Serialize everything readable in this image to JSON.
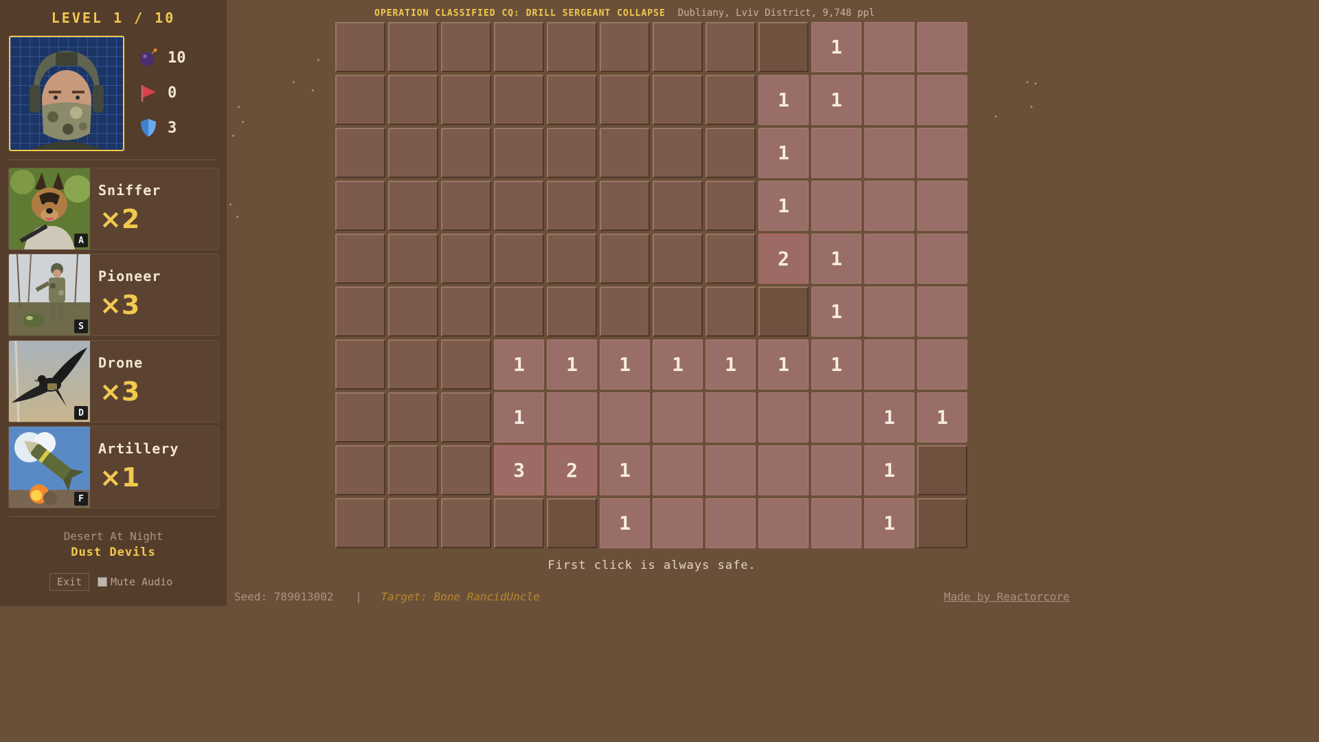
{
  "sidebar": {
    "level_text": "LEVEL 1 / 10",
    "stats": {
      "mines": "10",
      "flags": "0",
      "shields": "3"
    },
    "units": [
      {
        "name": "Sniffer",
        "count": "×2",
        "key": "A",
        "icon": "dog-icon"
      },
      {
        "name": "Pioneer",
        "count": "×3",
        "key": "S",
        "icon": "soldier-icon"
      },
      {
        "name": "Drone",
        "count": "×3",
        "key": "D",
        "icon": "bird-drone-icon"
      },
      {
        "name": "Artillery",
        "count": "×1",
        "key": "F",
        "icon": "missile-icon"
      }
    ],
    "theme": "Desert At Night",
    "theme_name": "Dust Devils",
    "exit_label": "Exit",
    "mute_label": "Mute Audio"
  },
  "header": {
    "title": "OPERATION CLASSIFIED CQ: DRILL SERGEANT COLLAPSE",
    "location": "Dubliany, Lviv District, 9,748 ppl"
  },
  "board": {
    "legend": "H = hidden tile, D = hidden darker tile, . = revealed empty, digit = revealed number",
    "rows": [
      [
        "H",
        "H",
        "H",
        "H",
        "H",
        "H",
        "H",
        "H",
        "D",
        "1",
        ".",
        "."
      ],
      [
        "H",
        "H",
        "H",
        "H",
        "H",
        "H",
        "H",
        "H",
        "1",
        "1",
        ".",
        "."
      ],
      [
        "H",
        "H",
        "H",
        "H",
        "H",
        "H",
        "H",
        "H",
        "1",
        ".",
        ".",
        "."
      ],
      [
        "H",
        "H",
        "H",
        "H",
        "H",
        "H",
        "H",
        "H",
        "1",
        ".",
        ".",
        "."
      ],
      [
        "H",
        "H",
        "H",
        "H",
        "H",
        "H",
        "H",
        "H",
        "2",
        "1",
        ".",
        "."
      ],
      [
        "H",
        "H",
        "H",
        "H",
        "H",
        "H",
        "H",
        "H",
        "D",
        "1",
        ".",
        "."
      ],
      [
        "H",
        "H",
        "H",
        "1",
        "1",
        "1",
        "1",
        "1",
        "1",
        "1",
        ".",
        "."
      ],
      [
        "H",
        "H",
        "H",
        "1",
        ".",
        ".",
        ".",
        ".",
        ".",
        ".",
        "1",
        "1"
      ],
      [
        "H",
        "H",
        "H",
        "3",
        "2",
        "1",
        ".",
        ".",
        ".",
        ".",
        "1",
        "D"
      ],
      [
        "H",
        "H",
        "H",
        "H",
        "D",
        "1",
        ".",
        ".",
        ".",
        ".",
        "1",
        "D"
      ]
    ]
  },
  "hint": "First click is always safe.",
  "footer": {
    "seed": "Seed: 789013002",
    "separator": "|",
    "target": "Target: Bone RancidUncle",
    "credit": "Made by Reactorcore"
  },
  "colors": {
    "accent": "#f1c94f",
    "background": "#6b5039",
    "sidebar": "#553d2b",
    "hidden_tile": "#7d5b4c",
    "revealed_tile": "#9a6e68"
  }
}
